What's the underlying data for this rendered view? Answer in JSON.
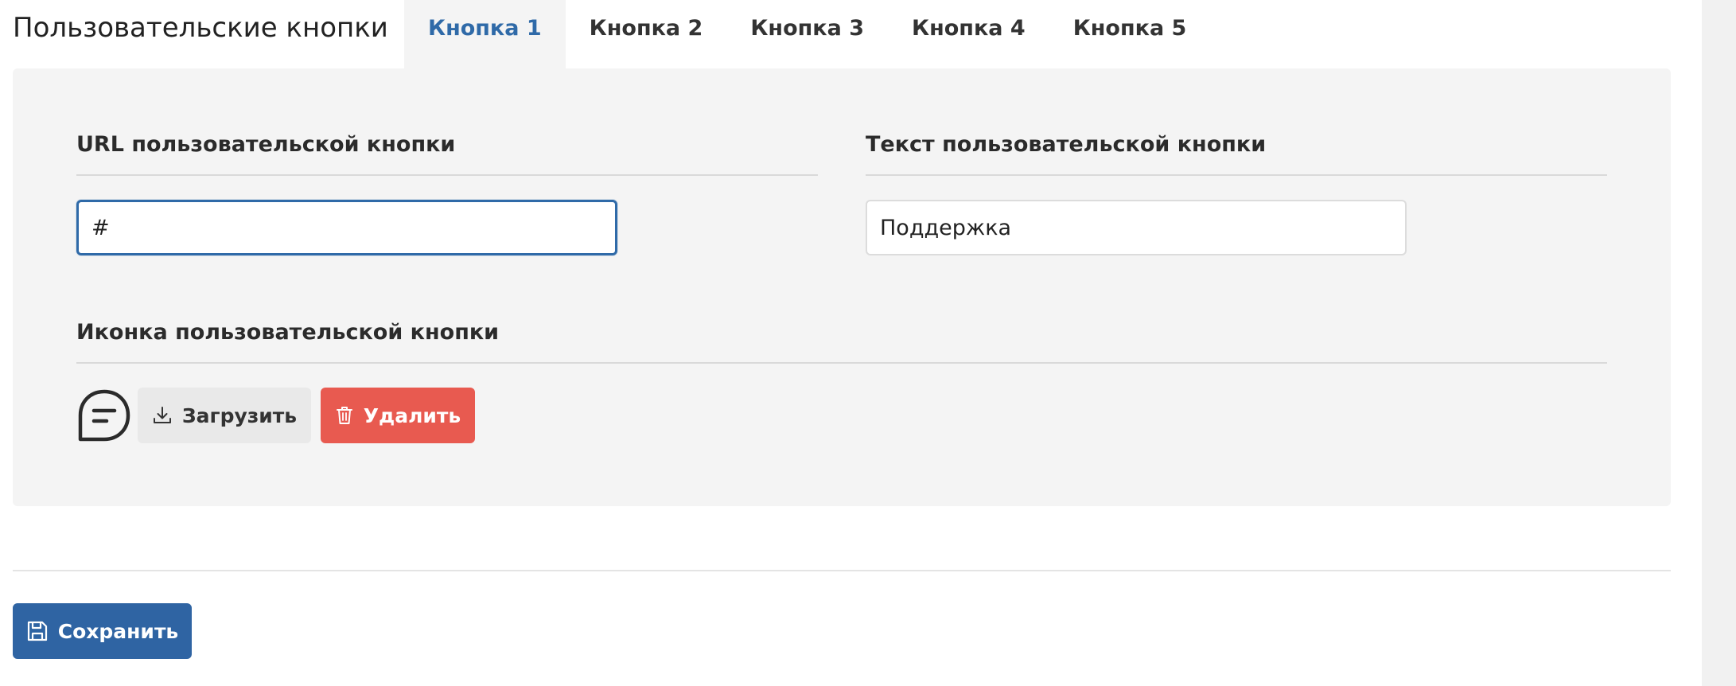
{
  "header": {
    "title": "Пользовательские кнопки"
  },
  "tabs": [
    {
      "label": "Кнопка 1",
      "active": true
    },
    {
      "label": "Кнопка 2",
      "active": false
    },
    {
      "label": "Кнопка 3",
      "active": false
    },
    {
      "label": "Кнопка 4",
      "active": false
    },
    {
      "label": "Кнопка 5",
      "active": false
    }
  ],
  "form": {
    "url_label": "URL пользовательской кнопки",
    "url_value": "#",
    "text_label": "Текст пользовательской кнопки",
    "text_value": "Поддержка",
    "icon_label": "Иконка пользовательской кнопки",
    "icon_name": "chat-bubble-icon",
    "upload_label": "Загрузить",
    "delete_label": "Удалить"
  },
  "footer": {
    "save_label": "Сохранить"
  },
  "colors": {
    "accent": "#2f6aa8",
    "danger": "#e85a50",
    "panel": "#f4f4f4"
  }
}
